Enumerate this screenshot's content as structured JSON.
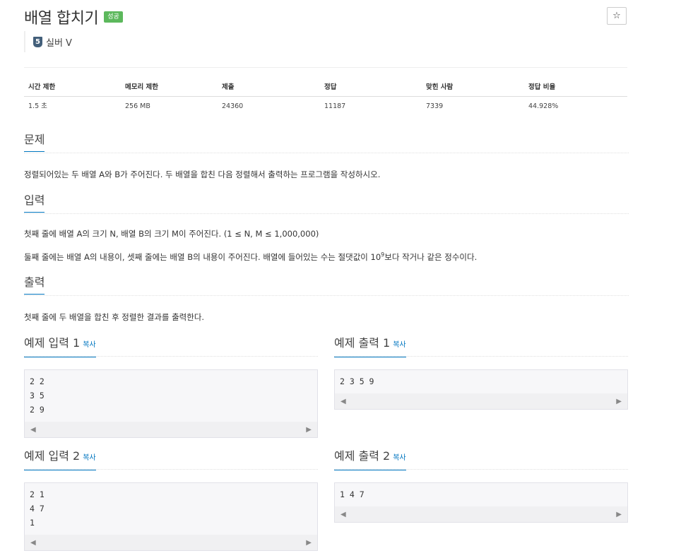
{
  "problem": {
    "title": "배열 합치기",
    "status_badge": "성공",
    "star_icon": "☆",
    "tier_number": "5",
    "tier_label": "실버 V"
  },
  "stats": {
    "headers": [
      "시간 제한",
      "메모리 제한",
      "제출",
      "정답",
      "맞힌 사람",
      "정답 비율"
    ],
    "values": [
      "1.5 초",
      "256 MB",
      "24360",
      "11187",
      "7339",
      "44.928%"
    ]
  },
  "sections": {
    "problem_title": "문제",
    "problem_text": "정렬되어있는 두 배열 A와 B가 주어진다. 두 배열을 합친 다음 정렬해서 출력하는 프로그램을 작성하시오.",
    "input_title": "입력",
    "input_line1": "첫째 줄에 배열 A의 크기 N, 배열 B의 크기 M이 주어진다. (1 ≤ N, M ≤ 1,000,000)",
    "input_line2_a": "둘째 줄에는 배열 A의 내용이, 셋째 줄에는 배열 B의 내용이 주어진다. 배열에 들어있는 수는 절댓값이 10",
    "input_line2_sup": "9",
    "input_line2_b": "보다 작거나 같은 정수이다.",
    "output_title": "출력",
    "output_text": "첫째 줄에 두 배열을 합친 후 정렬한 결과를 출력한다."
  },
  "samples": {
    "copy_label": "복사",
    "input1_title": "예제 입력 1",
    "input1_code": "2 2\n3 5\n2 9",
    "output1_title": "예제 출력 1",
    "output1_code": "2 3 5 9",
    "input2_title": "예제 입력 2",
    "input2_code": "2 1\n4 7\n1",
    "output2_title": "예제 출력 2",
    "output2_code": "1 4 7"
  },
  "colors": {
    "accent": "#0076c0",
    "success": "#5cb85c",
    "tier": "#435f7a"
  }
}
